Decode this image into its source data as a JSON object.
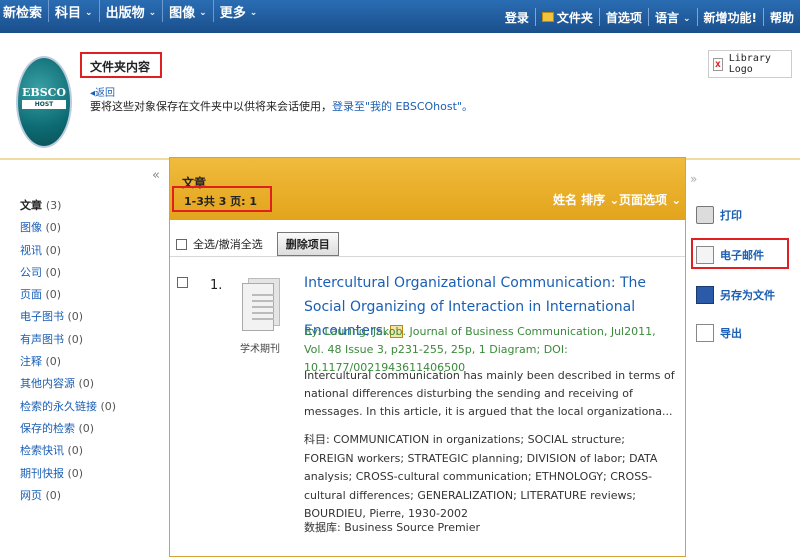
{
  "topnav": {
    "left": [
      {
        "label": "新检索",
        "dropdown": false
      },
      {
        "label": "科目",
        "dropdown": true
      },
      {
        "label": "出版物",
        "dropdown": true
      },
      {
        "label": "图像",
        "dropdown": true
      },
      {
        "label": "更多",
        "dropdown": true
      }
    ],
    "right": [
      {
        "label": "登录"
      },
      {
        "label": "文件夹"
      },
      {
        "label": "首选项"
      },
      {
        "label": "语言"
      },
      {
        "label": "新增功能!"
      },
      {
        "label": "帮助"
      }
    ]
  },
  "header": {
    "logo_text": "EBSCO",
    "logo_sub": "HOST",
    "title": "文件夹内容",
    "back": "返回",
    "instruction": "要将这些对象保存在文件夹中以供将来会话使用，",
    "login_link": "登录至\"我的 EBSCOhost\"。",
    "library_logo": "Library Logo"
  },
  "facets": [
    {
      "label": "文章",
      "count": "(3)"
    },
    {
      "label": "图像",
      "count": "(0)"
    },
    {
      "label": "视讯",
      "count": "(0)"
    },
    {
      "label": "公司",
      "count": "(0)"
    },
    {
      "label": "页面",
      "count": "(0)"
    },
    {
      "label": "电子图书",
      "count": "(0)"
    },
    {
      "label": "有声图书",
      "count": "(0)"
    },
    {
      "label": "注释",
      "count": "(0)"
    },
    {
      "label": "其他内容源",
      "count": "(0)"
    },
    {
      "label": "检索的永久链接",
      "count": "(0)"
    },
    {
      "label": "保存的检索",
      "count": "(0)"
    },
    {
      "label": "检索快讯",
      "count": "(0)"
    },
    {
      "label": "期刊快报",
      "count": "(0)"
    },
    {
      "label": "网页",
      "count": "(0)"
    }
  ],
  "main": {
    "section_label": "文章",
    "range": "1-3共 3  页: 1",
    "sort": "姓名 排序",
    "page_options": "页面选项",
    "select_all": "全选/撤消全选",
    "delete": "删除项目"
  },
  "result": {
    "number": "1.",
    "type": "学术期刊",
    "title": "Intercultural Organizational Communication: The Social Organizing of Interaction in International Encounters.",
    "byline": "By: Lauring, Jakob. Journal of Business Communication, Jul2011, Vol. 48 Issue 3, p231-255, 25p, 1 Diagram; DOI: 10.1177/0021943611406500",
    "abstract": "Intercultural communication has mainly been described in terms of national differences disturbing the sending and receiving of messages. In this article, it is argued that the local organizationa...",
    "subjects": "科目: COMMUNICATION in organizations; SOCIAL structure; FOREIGN workers; STRATEGIC planning; DIVISION of labor; DATA analysis; CROSS-cultural communication; ETHNOLOGY; CROSS-cultural differences; GENERALIZATION; LITERATURE reviews; BOURDIEU, Pierre, 1930-2002",
    "database": "数据库: Business Source Premier"
  },
  "tools": [
    {
      "label": "打印",
      "icon": "printer-icon"
    },
    {
      "label": "电子邮件",
      "icon": "email-icon"
    },
    {
      "label": "另存为文件",
      "icon": "save-file-icon"
    },
    {
      "label": "导出",
      "icon": "export-icon"
    }
  ],
  "colors": {
    "topbar": "#1a4f8c",
    "panel_header": "#e8ad2a",
    "link": "#1a5fb4",
    "highlight": "#e02020"
  }
}
